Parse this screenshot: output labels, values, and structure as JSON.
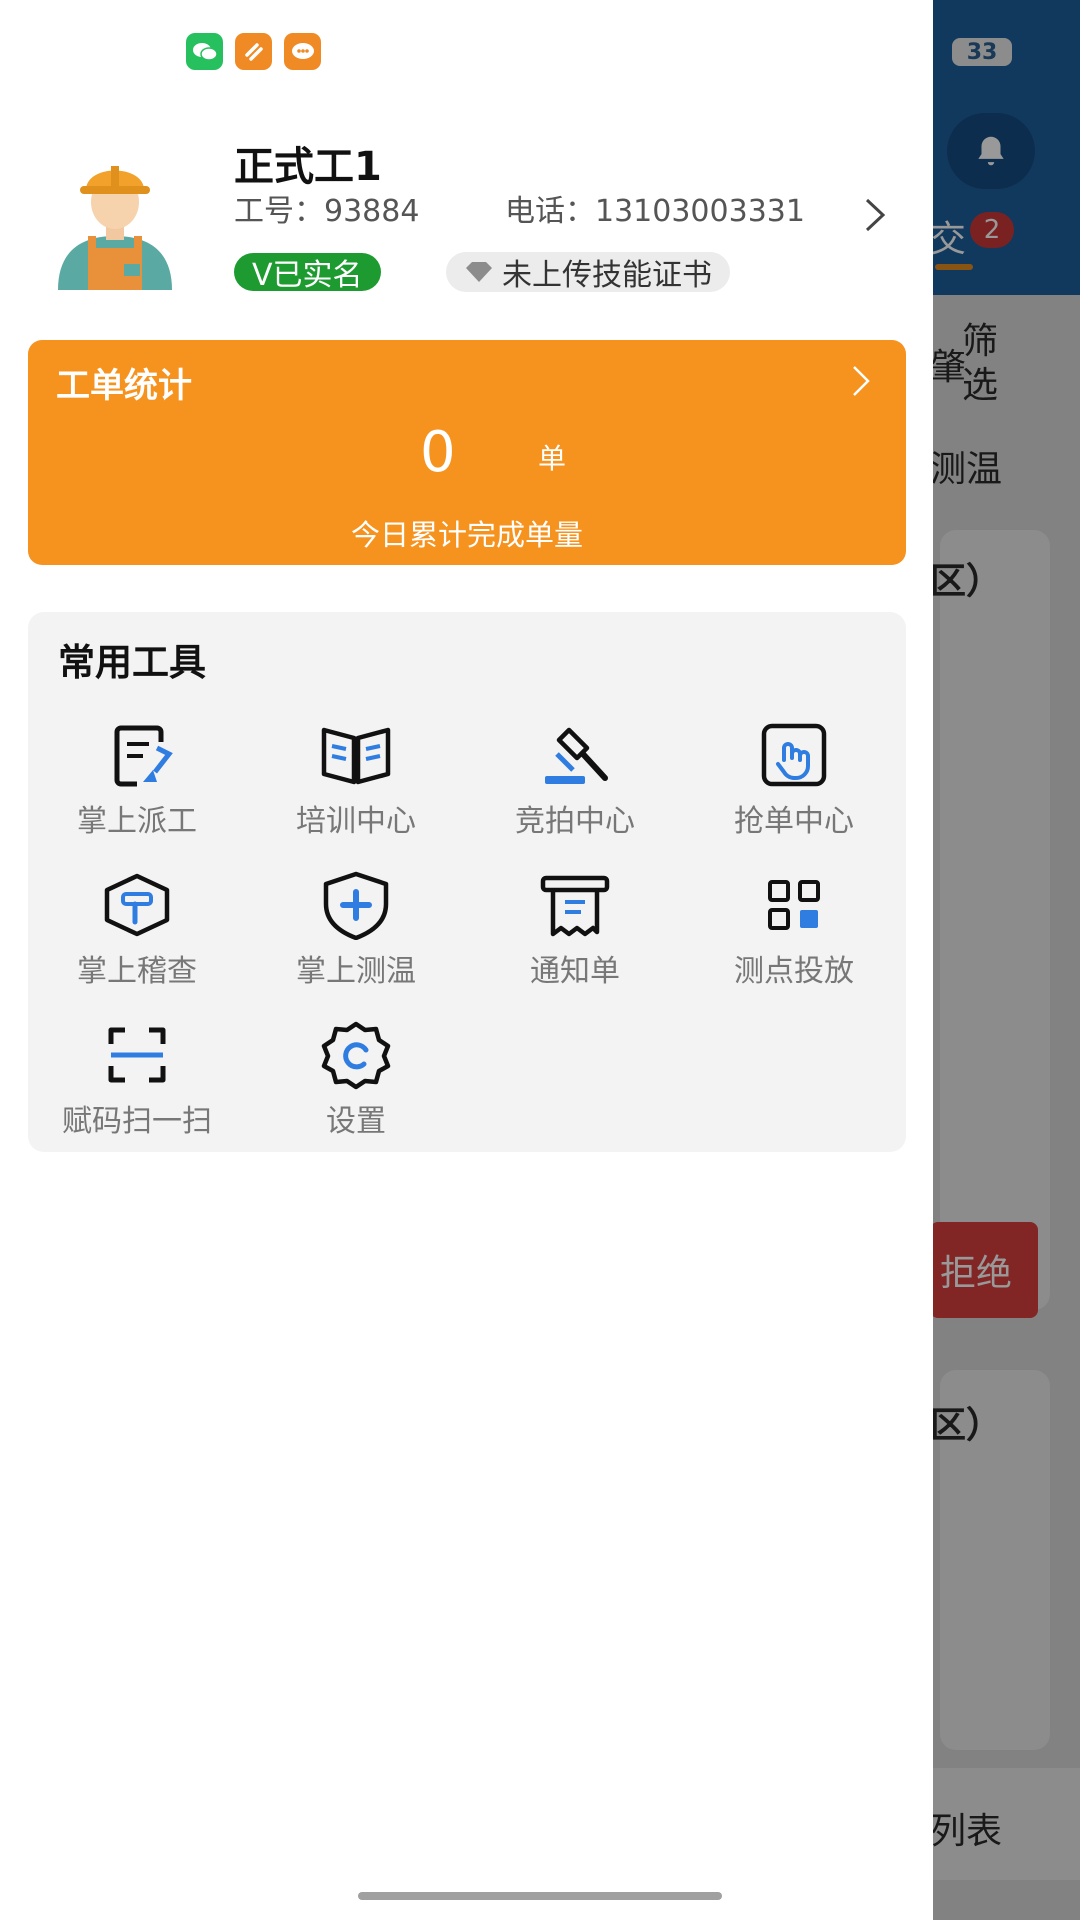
{
  "background": {
    "battery": "33",
    "tab_badge": "2",
    "tab_fragment": "交",
    "filter_label": "筛选",
    "filter_fragment": "肇",
    "temp_fragment": "测温",
    "area_fragment_1": "区）",
    "refuse_fragment": "拒绝",
    "area_fragment_2": "区）",
    "list_fragment": "列表"
  },
  "status_bar": {
    "icons": [
      "wechat-icon",
      "app-orange-icon",
      "chat-orange-icon"
    ]
  },
  "profile": {
    "name": "正式工1",
    "employee_no_label": "工号：",
    "employee_no": "93884",
    "phone_label": "电话：",
    "phone": "13103003331",
    "verified": "V已实名",
    "cert_status": "未上传技能证书"
  },
  "stats": {
    "title": "工单统计",
    "value": "0",
    "unit": "单",
    "caption": "今日累计完成单量"
  },
  "tools": {
    "title": "常用工具",
    "items": [
      {
        "label": "掌上派工",
        "icon": "dispatch-icon"
      },
      {
        "label": "培训中心",
        "icon": "book-icon"
      },
      {
        "label": "竞拍中心",
        "icon": "gavel-icon"
      },
      {
        "label": "抢单中心",
        "icon": "tap-icon"
      },
      {
        "label": "掌上稽查",
        "icon": "hammer-icon"
      },
      {
        "label": "掌上测温",
        "icon": "shield-plus-icon"
      },
      {
        "label": "通知单",
        "icon": "receipt-icon"
      },
      {
        "label": "测点投放",
        "icon": "grid-icon"
      },
      {
        "label": "赋码扫一扫",
        "icon": "scan-icon"
      },
      {
        "label": "设置",
        "icon": "settings-gear-icon"
      }
    ]
  },
  "colors": {
    "accent_orange": "#f6931f",
    "verified_green": "#1e9b30",
    "icon_blue": "#2f7de1",
    "header_blue": "#1d5f9b"
  }
}
